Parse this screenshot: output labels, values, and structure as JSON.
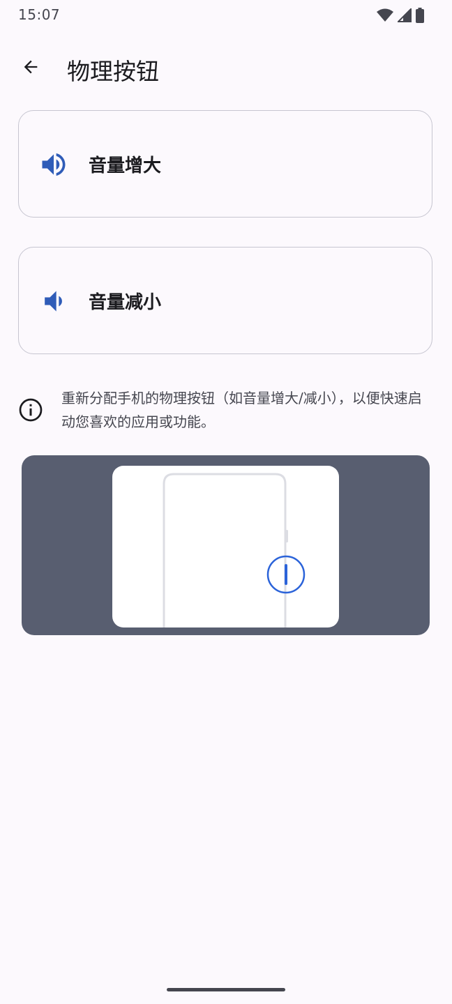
{
  "status_bar": {
    "time": "15:07",
    "icons": [
      "wifi-icon",
      "signal-icon",
      "battery-icon"
    ]
  },
  "app_bar": {
    "back_icon": "arrow-back-icon",
    "title": "物理按钮"
  },
  "options": [
    {
      "label": "音量增大",
      "icon": "volume-up-icon"
    },
    {
      "label": "音量减小",
      "icon": "volume-down-icon"
    }
  ],
  "info": {
    "icon": "info-icon",
    "text": "重新分配手机的物理按钮（如音量增大/减小），以便快速启动您喜欢的应用或功能。"
  },
  "illustration": {
    "description_icon": "phone-side-button-illustration"
  },
  "colors": {
    "accent": "#2f5cb8",
    "background": "#fcf9fd",
    "card_border": "#c6c5d0",
    "illustration_bg": "#585e70",
    "highlight_ring": "#2b63d9"
  }
}
